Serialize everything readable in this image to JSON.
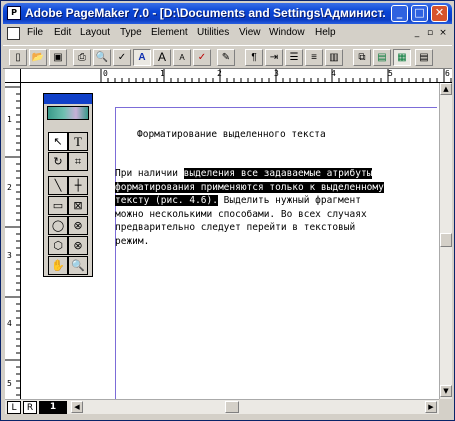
{
  "window": {
    "title": "Adobe PageMaker 7.0 - [D:\\Documents and Settings\\Админист...",
    "minimize_symbol": "_",
    "maximize_symbol": "□",
    "close_symbol": "✕"
  },
  "menu": {
    "items": [
      "File",
      "Edit",
      "Layout",
      "Type",
      "Element",
      "Utilities",
      "View",
      "Window",
      "Help"
    ],
    "doc_minimize": "_",
    "doc_restore": "▫",
    "doc_close": "×"
  },
  "toolbar": {
    "buttons": [
      {
        "icon": "new-document-icon",
        "glyph": "▯"
      },
      {
        "icon": "open-folder-icon",
        "glyph": "📂"
      },
      {
        "icon": "save-icon",
        "glyph": "▣"
      },
      {
        "icon": "print-icon",
        "glyph": "⎙"
      },
      {
        "icon": "find-icon",
        "glyph": "🔍"
      },
      {
        "icon": "spell-check-icon",
        "glyph": "✓"
      },
      {
        "icon": "text-format-icon",
        "glyph": "A"
      },
      {
        "icon": "font-grow-icon",
        "glyph": "A"
      },
      {
        "icon": "font-shrink-icon",
        "glyph": "A"
      },
      {
        "icon": "spelling-icon",
        "glyph": "✓"
      },
      {
        "icon": "picture-edit-icon",
        "glyph": "✎"
      },
      {
        "icon": "paragraph-icon",
        "glyph": "¶"
      },
      {
        "icon": "indent-icon",
        "glyph": "⇥"
      },
      {
        "icon": "bullets-icon",
        "glyph": "☰"
      },
      {
        "icon": "align-icon",
        "glyph": "≡"
      },
      {
        "icon": "columns-icon",
        "glyph": "▥"
      },
      {
        "icon": "copy-icon",
        "glyph": "⧉"
      },
      {
        "icon": "frame-icon",
        "glyph": "▤"
      },
      {
        "icon": "layout-icon",
        "glyph": "▦"
      },
      {
        "icon": "more-icon",
        "glyph": "▤"
      }
    ]
  },
  "rulers": {
    "horizontal_labels": [
      "0",
      "1",
      "2",
      "3",
      "4",
      "5",
      "6"
    ],
    "vertical_labels": [
      "1",
      "2",
      "3",
      "4",
      "5"
    ]
  },
  "document": {
    "heading": "Форматирование выделенного текста",
    "body_lines": [
      {
        "before": "При наличии ",
        "selected": "выделения все задаваемые атрибуты",
        "after": ""
      },
      {
        "before": "",
        "selected": "форматирования применяются только к выделенному",
        "after": ""
      },
      {
        "before": "",
        "selected": "тексту (рис. 4.6).",
        "after": " Выделить нужный фрагмент"
      },
      {
        "before": "можно несколькими способами. Во всех случаях",
        "selected": "",
        "after": ""
      },
      {
        "before": "предварительно следует перейти в текстовый",
        "selected": "",
        "after": ""
      },
      {
        "before": "режим.",
        "selected": "",
        "after": ""
      }
    ]
  },
  "toolbox": {
    "tools": [
      {
        "name": "pointer-tool-icon",
        "glyph": "↖"
      },
      {
        "name": "text-tool-icon",
        "glyph": "T"
      },
      {
        "name": "rotate-tool-icon",
        "glyph": "↻"
      },
      {
        "name": "crop-tool-icon",
        "glyph": "⌗"
      },
      {
        "name": "line-tool-icon",
        "glyph": "╲"
      },
      {
        "name": "constrained-line-tool-icon",
        "glyph": "┼"
      },
      {
        "name": "rectangle-tool-icon",
        "glyph": "▭"
      },
      {
        "name": "rectangle-frame-tool-icon",
        "glyph": "⊠"
      },
      {
        "name": "ellipse-tool-icon",
        "glyph": "◯"
      },
      {
        "name": "ellipse-frame-tool-icon",
        "glyph": "⊗"
      },
      {
        "name": "polygon-tool-icon",
        "glyph": "⬡"
      },
      {
        "name": "polygon-frame-tool-icon",
        "glyph": "⊗"
      },
      {
        "name": "hand-tool-icon",
        "glyph": "✋"
      },
      {
        "name": "zoom-tool-icon",
        "glyph": "🔍"
      }
    ]
  },
  "pages": {
    "left_label": "L",
    "right_label": "R",
    "current_page": "1"
  }
}
